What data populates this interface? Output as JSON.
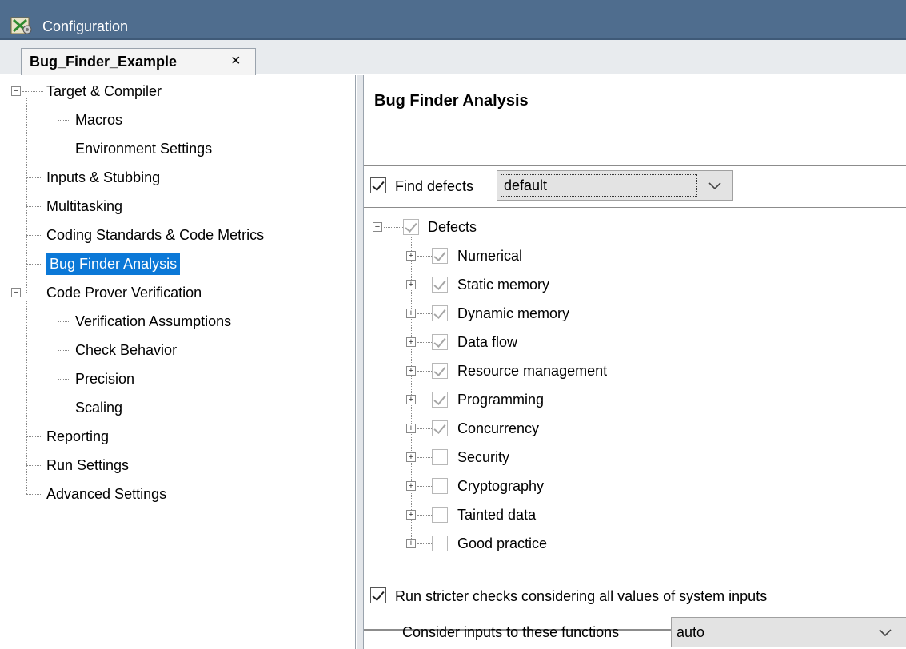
{
  "window": {
    "title": "Configuration"
  },
  "tabs": [
    {
      "label": "Bug_Finder_Example",
      "close": "×"
    }
  ],
  "tree": {
    "items": [
      {
        "label": "Target & Compiler"
      },
      {
        "label": "Macros"
      },
      {
        "label": "Environment Settings"
      },
      {
        "label": "Inputs & Stubbing"
      },
      {
        "label": "Multitasking"
      },
      {
        "label": "Coding Standards & Code Metrics"
      },
      {
        "label": "Bug Finder Analysis",
        "selected": true
      },
      {
        "label": "Code Prover Verification"
      },
      {
        "label": "Verification Assumptions"
      },
      {
        "label": "Check Behavior"
      },
      {
        "label": "Precision"
      },
      {
        "label": "Scaling"
      },
      {
        "label": "Reporting"
      },
      {
        "label": "Run Settings"
      },
      {
        "label": "Advanced Settings"
      }
    ]
  },
  "panel": {
    "title": "Bug Finder Analysis",
    "find_defects": {
      "label": "Find defects",
      "checked": true,
      "value": "default"
    },
    "defects_root": {
      "label": "Defects"
    },
    "defects": [
      {
        "label": "Numerical",
        "checked": true
      },
      {
        "label": "Static memory",
        "checked": true
      },
      {
        "label": "Dynamic memory",
        "checked": true
      },
      {
        "label": "Data flow",
        "checked": true
      },
      {
        "label": "Resource management",
        "checked": true
      },
      {
        "label": "Programming",
        "checked": true
      },
      {
        "label": "Concurrency",
        "checked": true
      },
      {
        "label": "Security",
        "checked": false
      },
      {
        "label": "Cryptography",
        "checked": false
      },
      {
        "label": "Tainted data",
        "checked": false
      },
      {
        "label": "Good practice",
        "checked": false
      }
    ],
    "stricter": {
      "label": "Run stricter checks considering all values of system inputs",
      "checked": true
    },
    "consider_inputs": {
      "label": "Consider inputs to these functions",
      "value": "auto"
    }
  },
  "colors": {
    "titlebar": "#4f6d8e",
    "selection": "#0b78d7"
  }
}
